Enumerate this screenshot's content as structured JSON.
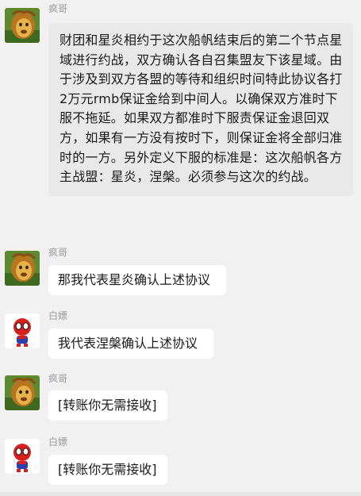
{
  "messages": [
    {
      "sender": "疯哥",
      "avatar_icon": "lion-king-avatar",
      "text": "财团和星炎相约于这次船帆结束后的第二个节点星域进行约战，双方确认各自召集盟友下该星域。由于涉及到双方各盟的等待和组织时间特此协议各打2万元rmb保证金给到中间人。以确保双方准时下服不拖延。如果双方都准时下服责保证金退回双方，如果有一方没有按时下，则保证金将全部归准时的一方。另外定义下服的标准是：这次船帆各方主战盟：星炎，涅槃。必须参与这次的约战。"
    },
    {
      "sender": "疯哥",
      "avatar_icon": "lion-king-avatar",
      "text": "那我代表星炎确认上述协议"
    },
    {
      "sender": "白嫖",
      "avatar_icon": "spiderman-avatar",
      "text": "我代表涅槃确认上述协议"
    },
    {
      "sender": "疯哥",
      "avatar_icon": "lion-king-avatar",
      "text": "[转账你无需接收]"
    },
    {
      "sender": "白嫖",
      "avatar_icon": "spiderman-avatar",
      "text": "[转账你无需接收]"
    }
  ],
  "colors": {
    "background": "#f1f1f1",
    "bubble_long": "#e9e9e9",
    "bubble": "#ffffff",
    "name_text": "#9a9a9a"
  }
}
